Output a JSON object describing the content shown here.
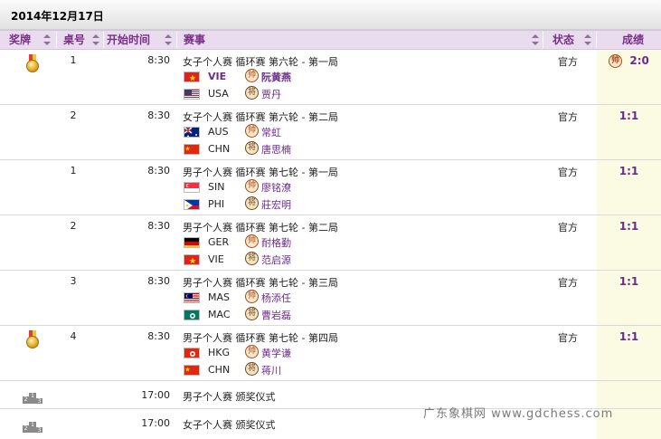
{
  "date": "2014年12月17日",
  "headers": {
    "medal": "奖牌",
    "table_no": "桌号",
    "start_time": "开始时间",
    "event": "赛事",
    "status": "状态",
    "result": "成绩"
  },
  "badges": {
    "red": "帅",
    "black": "将"
  },
  "rows": [
    {
      "table_no": "1",
      "start_time": "8:30",
      "event": "女子个人赛 循环赛 第六轮 - 第一局",
      "status": "官方",
      "result": "2:0",
      "red": {
        "country": "VIE",
        "name": "阮黄燕",
        "flag": "vie"
      },
      "black": {
        "country": "USA",
        "name": "贾丹",
        "flag": "usa"
      }
    },
    {
      "table_no": "2",
      "start_time": "8:30",
      "event": "女子个人赛 循环赛 第六轮 - 第二局",
      "status": "官方",
      "result": "1:1",
      "red": {
        "country": "AUS",
        "name": "常虹",
        "flag": "aus"
      },
      "black": {
        "country": "CHN",
        "name": "唐思楠",
        "flag": "chn"
      }
    },
    {
      "table_no": "1",
      "start_time": "8:30",
      "event": "男子个人赛 循环赛 第七轮 - 第一局",
      "status": "官方",
      "result": "1:1",
      "red": {
        "country": "SIN",
        "name": "廖铭潦",
        "flag": "sin"
      },
      "black": {
        "country": "PHI",
        "name": "莊宏明",
        "flag": "phi"
      }
    },
    {
      "table_no": "2",
      "start_time": "8:30",
      "event": "男子个人赛 循环赛 第七轮 - 第二局",
      "status": "官方",
      "result": "1:1",
      "red": {
        "country": "GER",
        "name": "耐格勤",
        "flag": "ger"
      },
      "black": {
        "country": "VIE",
        "name": "范启源",
        "flag": "vie"
      }
    },
    {
      "table_no": "3",
      "start_time": "8:30",
      "event": "男子个人赛 循环赛 第七轮 - 第三局",
      "status": "官方",
      "result": "1:1",
      "red": {
        "country": "MAS",
        "name": "杨添任",
        "flag": "mas"
      },
      "black": {
        "country": "MAC",
        "name": "曹岩磊",
        "flag": "mac"
      }
    },
    {
      "table_no": "4",
      "start_time": "8:30",
      "event": "男子个人赛 循环赛 第七轮 - 第四局",
      "status": "官方",
      "result": "1:1",
      "red": {
        "country": "HKG",
        "name": "黄学谦",
        "flag": "hkg"
      },
      "black": {
        "country": "CHN",
        "name": "蒋川",
        "flag": "chn"
      }
    }
  ],
  "ceremonies": [
    {
      "start_time": "17:00",
      "event": "男子个人赛 颁奖仪式"
    },
    {
      "start_time": "17:00",
      "event": "女子个人赛 颁奖仪式"
    }
  ],
  "watermark": "广东象棋网 www.gdchess.com"
}
